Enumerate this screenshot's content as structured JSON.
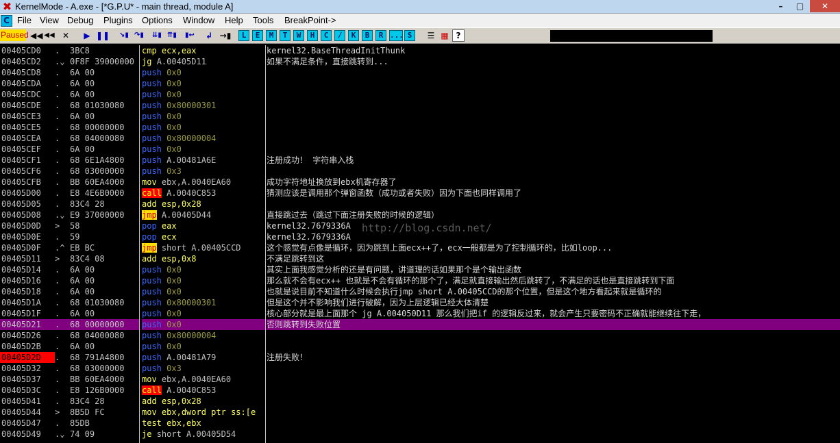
{
  "window": {
    "title": "KernelMode - A.exe - [*G.P.U* - main thread, module A]",
    "buttons": [
      "–",
      "□",
      "✕"
    ]
  },
  "menu": {
    "items": [
      "File",
      "View",
      "Debug",
      "Plugins",
      "Options",
      "Window",
      "Help",
      "Tools",
      "BreakPoint->"
    ]
  },
  "toolbar": {
    "status": "Paused",
    "letters": [
      "L",
      "E",
      "M",
      "T",
      "W",
      "H",
      "C",
      "/",
      "K",
      "B",
      "R",
      "...",
      "S"
    ]
  },
  "colors": {
    "highlight_row": "#800080",
    "breakpoint_address": "#ff0000",
    "jump_mnemonic_bg": "#ffe000",
    "call_mnemonic_bg": "#ff0000",
    "status_bg": "#ffe000"
  },
  "watermark": "http://blog.csdn.net/",
  "rows": [
    {
      "addr": "00405CD0",
      "arrow": ".",
      "hex": "3BC8",
      "mn": "cmp",
      "ops": "ecx,eax",
      "comment": "kernel32.BaseThreadInitThunk"
    },
    {
      "addr": "00405CD2",
      "arrow": ".v",
      "hex": "0F8F 39000000",
      "mn": "jg",
      "ops": "A.00405D11",
      "comment": "如果不满足条件，直接跳转到..."
    },
    {
      "addr": "00405CD8",
      "arrow": ".",
      "hex": "6A 00",
      "mn": "push",
      "ops": "0x0",
      "comment": ""
    },
    {
      "addr": "00405CDA",
      "arrow": ".",
      "hex": "6A 00",
      "mn": "push",
      "ops": "0x0",
      "comment": ""
    },
    {
      "addr": "00405CDC",
      "arrow": ".",
      "hex": "6A 00",
      "mn": "push",
      "ops": "0x0",
      "comment": ""
    },
    {
      "addr": "00405CDE",
      "arrow": ".",
      "hex": "68 01030080",
      "mn": "push",
      "ops": "0x80000301",
      "comment": ""
    },
    {
      "addr": "00405CE3",
      "arrow": ".",
      "hex": "6A 00",
      "mn": "push",
      "ops": "0x0",
      "comment": ""
    },
    {
      "addr": "00405CE5",
      "arrow": ".",
      "hex": "68 00000000",
      "mn": "push",
      "ops": "0x0",
      "comment": ""
    },
    {
      "addr": "00405CEA",
      "arrow": ".",
      "hex": "68 04000080",
      "mn": "push",
      "ops": "0x80000004",
      "comment": ""
    },
    {
      "addr": "00405CEF",
      "arrow": ".",
      "hex": "6A 00",
      "mn": "push",
      "ops": "0x0",
      "comment": ""
    },
    {
      "addr": "00405CF1",
      "arrow": ".",
      "hex": "68 6E1A4800",
      "mn": "push",
      "ops": "A.00481A6E",
      "comment": "注册成功！  字符串入栈"
    },
    {
      "addr": "00405CF6",
      "arrow": ".",
      "hex": "68 03000000",
      "mn": "push",
      "ops": "0x3",
      "comment": ""
    },
    {
      "addr": "00405CFB",
      "arrow": ".",
      "hex": "BB 60EA4000",
      "mn": "mov",
      "ops": "ebx,A.0040EA60",
      "comment": "成功字符地址换放到ebx机寄存器了"
    },
    {
      "addr": "00405D00",
      "arrow": ".",
      "hex": "E8 4E6B0000",
      "mn": "call",
      "ops": "A.0040C853",
      "comment": "猜测应该是调用那个弹窗函数（成功或者失败）因为下面也同样调用了"
    },
    {
      "addr": "00405D05",
      "arrow": ".",
      "hex": "83C4 28",
      "mn": "add",
      "ops": "esp,0x28",
      "comment": ""
    },
    {
      "addr": "00405D08",
      "arrow": ".v",
      "hex": "E9 37000000",
      "mn": "jmp",
      "ops": "A.00405D44",
      "comment": "直接跳过去（跳过下面注册失败的时候的逻辑）"
    },
    {
      "addr": "00405D0D",
      "arrow": ">",
      "hex": "58",
      "mn": "pop",
      "ops": "eax",
      "comment": "kernel32.7679336A"
    },
    {
      "addr": "00405D0E",
      "arrow": ".",
      "hex": "59",
      "mn": "pop",
      "ops": "ecx",
      "comment": "kernel32.7679336A"
    },
    {
      "addr": "00405D0F",
      "arrow": ".^",
      "hex": "EB BC",
      "mn": "jmp",
      "ops": "short A.00405CCD",
      "comment": "这个感觉有点像是循环，因为跳到上面ecx++了，ecx一般都是为了控制循环的，比如loop..."
    },
    {
      "addr": "00405D11",
      "arrow": ">",
      "hex": "83C4 08",
      "mn": "add",
      "ops": "esp,0x8",
      "comment": "不满足跳转到这"
    },
    {
      "addr": "00405D14",
      "arrow": ".",
      "hex": "6A 00",
      "mn": "push",
      "ops": "0x0",
      "comment": "其实上面我感觉分析的还是有问题，讲道理的话如果那个是个输出函数"
    },
    {
      "addr": "00405D16",
      "arrow": ".",
      "hex": "6A 00",
      "mn": "push",
      "ops": "0x0",
      "comment": "那么就不会有ecx++  也就是不会有循环的那个了，满足就直接输出然后跳转了，不满足的话也是直接跳转到下面"
    },
    {
      "addr": "00405D18",
      "arrow": ".",
      "hex": "6A 00",
      "mn": "push",
      "ops": "0x0",
      "comment": "也就是说目前不知道什么时候会执行jmp short A.00405CCD的那个位置，但是这个地方看起来就是循环的"
    },
    {
      "addr": "00405D1A",
      "arrow": ".",
      "hex": "68 01030080",
      "mn": "push",
      "ops": "0x80000301",
      "comment": "但是这个并不影响我们进行破解，因为上层逻辑已经大体清楚"
    },
    {
      "addr": "00405D1F",
      "arrow": ".",
      "hex": "6A 00",
      "mn": "push",
      "ops": "0x0",
      "comment": "核心部分就是最上面那个 jg A.004050D11 那么我们把if 的逻辑反过来，就会产生只要密码不正确就能继续往下走，"
    },
    {
      "addr": "00405D21",
      "arrow": ".",
      "hex": "68 00000000",
      "mn": "push",
      "ops": "0x0",
      "comment": "否则跳转到失败位置",
      "highlight": true
    },
    {
      "addr": "00405D26",
      "arrow": ".",
      "hex": "68 04000080",
      "mn": "push",
      "ops": "0x80000004",
      "comment": ""
    },
    {
      "addr": "00405D2B",
      "arrow": ".",
      "hex": "6A 00",
      "mn": "push",
      "ops": "0x0",
      "comment": ""
    },
    {
      "addr": "00405D2D",
      "arrow": ".",
      "hex": "68 791A4800",
      "mn": "push",
      "ops": "A.00481A79",
      "comment": "注册失败！",
      "breakpoint": true
    },
    {
      "addr": "00405D32",
      "arrow": ".",
      "hex": "68 03000000",
      "mn": "push",
      "ops": "0x3",
      "comment": ""
    },
    {
      "addr": "00405D37",
      "arrow": ".",
      "hex": "BB 60EA4000",
      "mn": "mov",
      "ops": "ebx,A.0040EA60",
      "comment": ""
    },
    {
      "addr": "00405D3C",
      "arrow": ".",
      "hex": "E8 126B0000",
      "mn": "call",
      "ops": "A.0040C853",
      "comment": ""
    },
    {
      "addr": "00405D41",
      "arrow": ".",
      "hex": "83C4 28",
      "mn": "add",
      "ops": "esp,0x28",
      "comment": ""
    },
    {
      "addr": "00405D44",
      "arrow": ">",
      "hex": "8B5D FC",
      "mn": "mov",
      "ops": "ebx,dword ptr ss:[e",
      "comment": ""
    },
    {
      "addr": "00405D47",
      "arrow": ".",
      "hex": "85DB",
      "mn": "test",
      "ops": "ebx,ebx",
      "comment": ""
    },
    {
      "addr": "00405D49",
      "arrow": ".v",
      "hex": "74 09",
      "mn": "je",
      "ops": "short A.00405D54",
      "comment": ""
    }
  ]
}
